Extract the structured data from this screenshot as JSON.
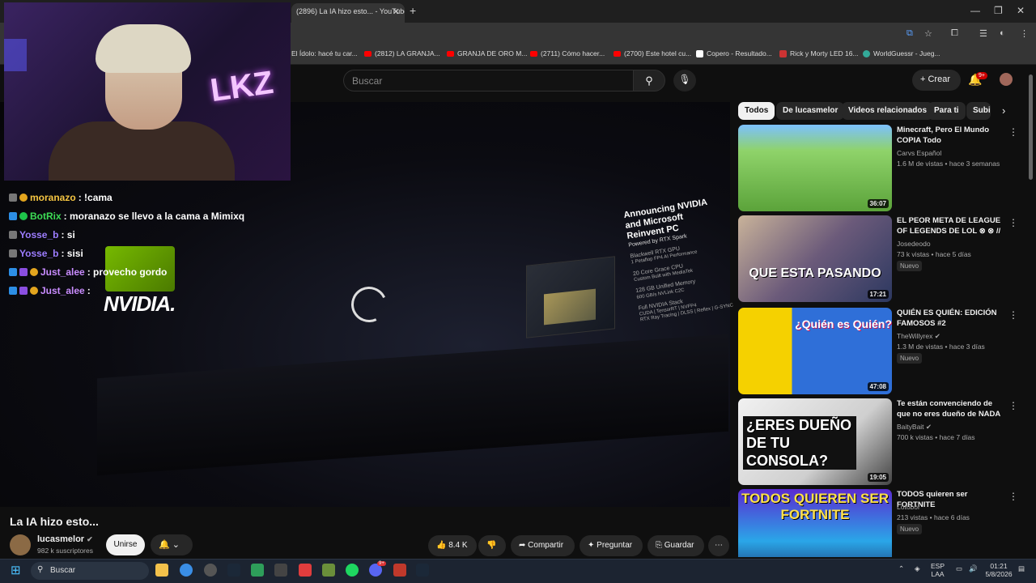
{
  "browser": {
    "tab_title": "(2896) La IA hizo esto... - YouTube",
    "tab_close": "✕",
    "new_tab": "+",
    "bookmarks": [
      "El Ídolo: hacé tu car...",
      "(2812) LA GRANJA...",
      "GRANJA DE ORO M...",
      "(2711) Cómo hacer...",
      "(2700) Este hotel cu...",
      "Copero - Resultado...",
      "Rick y Morty LED 16...",
      "WorldGuessr - Jueg..."
    ]
  },
  "header": {
    "search_placeholder": "Buscar",
    "create_label": "Crear",
    "notif_count": "9+"
  },
  "video": {
    "title": "La IA hizo esto...",
    "channel": "lucasmelor",
    "subscribers": "982 k suscriptores",
    "join_label": "Unirse",
    "likes": "8.4 K",
    "share_label": "Compartir",
    "ask_label": "Preguntar",
    "save_label": "Guardar",
    "stage_text": {
      "headline": "Announcing NVIDIA and Microsoft Reinvent PC",
      "powered": "Powered by RTX Spark",
      "specs": [
        "Blackwell RTX GPU",
        "1 Petaflop FP4 AI Performance",
        "20 Core Grace CPU",
        "Custom Built with MediaTek",
        "128 GB Unified Memory",
        "600 GB/s NVLink C2C",
        "Full NVIDIA Stack",
        "CUDA | TensorRT | NVFP4",
        "RTX Ray Tracing | DLSS | Reflex | G-SYNC"
      ]
    }
  },
  "overlay": {
    "cam_neon": "LKZ",
    "nvidia_text": "NVIDIA.",
    "chat": [
      {
        "user": "moranazo",
        "msg": ": !cama",
        "color": "#f5c542"
      },
      {
        "user": "BotRix",
        "msg": ": moranazo se llevo a la cama a Mimixq",
        "color": "#3ddc55"
      },
      {
        "user": "Yosse_b",
        "msg": ": si",
        "color": "#9d7dff"
      },
      {
        "user": "Yosse_b",
        "msg": ": sisi",
        "color": "#9d7dff"
      },
      {
        "user": "Just_alee",
        "msg": ": provecho gordo",
        "color": "#c98cff"
      },
      {
        "user": "Just_alee",
        "msg": ":",
        "color": "#c98cff"
      }
    ]
  },
  "chips": [
    "Todos",
    "De lucasmelor",
    "Videos relacionados",
    "Para ti",
    "Subi"
  ],
  "recommendations": [
    {
      "title": "Minecraft, Pero El Mundo COPIA Todo",
      "channel": "Carvs Español",
      "meta": "1.6 M de vistas • hace 3 semanas",
      "duration": "36:07",
      "new": "",
      "thumb_text": ""
    },
    {
      "title": "EL PEOR META DE LEAGUE OF LEGENDS DE LOL ⊗ ⊗ // ...",
      "channel": "Josedeodo",
      "meta": "73 k vistas • hace 5 días",
      "duration": "17:21",
      "new": "Nuevo",
      "thumb_text": "QUE ESTA PASANDO"
    },
    {
      "title": "QUIÉN ES QUIÉN: EDICIÓN FAMOSOS #2",
      "channel": "TheWillyrex",
      "meta": "1.3 M de vistas • hace 3 días",
      "duration": "47:08",
      "new": "Nuevo",
      "thumb_text": "¿Quién es Quién?"
    },
    {
      "title": "Te están convenciendo de que no eres dueño de NADA",
      "channel": "BaityBait",
      "meta": "700 k vistas • hace 7 días",
      "duration": "19:05",
      "new": "",
      "thumb_text": "¿ERES DUEÑO DE TU CONSOLA?"
    },
    {
      "title": "TODOS quieren ser FORTNITE",
      "channel": "Lotoboi",
      "meta": "213 vistas • hace 6 días",
      "duration": "",
      "new": "Nuevo",
      "thumb_text": "TODOS QUIEREN SER FORTNITE"
    }
  ],
  "taskbar": {
    "search_label": "Buscar",
    "lang": "ESP",
    "lang2": "LAA",
    "time": "01:21",
    "date": "5/8/2026",
    "discord_badge": "9+"
  },
  "colors": {
    "accent": "#ff0000",
    "bg": "#0f0f0f",
    "nvidia_green": "#76b900"
  }
}
